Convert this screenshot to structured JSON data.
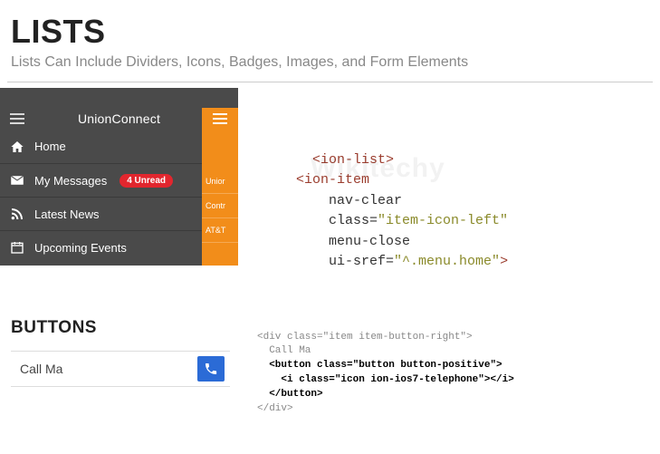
{
  "lists": {
    "title": "LISTS",
    "subtitle": "Lists Can Include Dividers, Icons, Badges, Images, and Form Elements"
  },
  "phone": {
    "app_title": "UnionConnect",
    "menu": [
      {
        "label": "Home"
      },
      {
        "label": "My Messages",
        "badge": "4 Unread"
      },
      {
        "label": "Latest News"
      },
      {
        "label": "Upcoming Events"
      }
    ],
    "right_list": [
      "Unior",
      "Contr",
      "AT&T"
    ]
  },
  "code1": {
    "l1a": "<ion-list>",
    "l2a": "<ion-item",
    "l3": "nav-clear",
    "l4a": "class=",
    "l4b": "\"item-icon-left\"",
    "l5": "menu-close",
    "l6a": "ui-sref=",
    "l6b": "\"^.menu.home\"",
    "l6c": ">"
  },
  "watermark": "Wikitechy",
  "buttons": {
    "title": "BUTTONS",
    "item_label": "Call Ma"
  },
  "code2": {
    "l1": "<div class=\"item item-button-right\">",
    "l2": "  Call Ma",
    "l3": "  <button class=\"button button-positive\">",
    "l4": "    <i class=\"icon ion-ios7-telephone\"></i>",
    "l5": "  </button>",
    "l6": "</div>"
  }
}
